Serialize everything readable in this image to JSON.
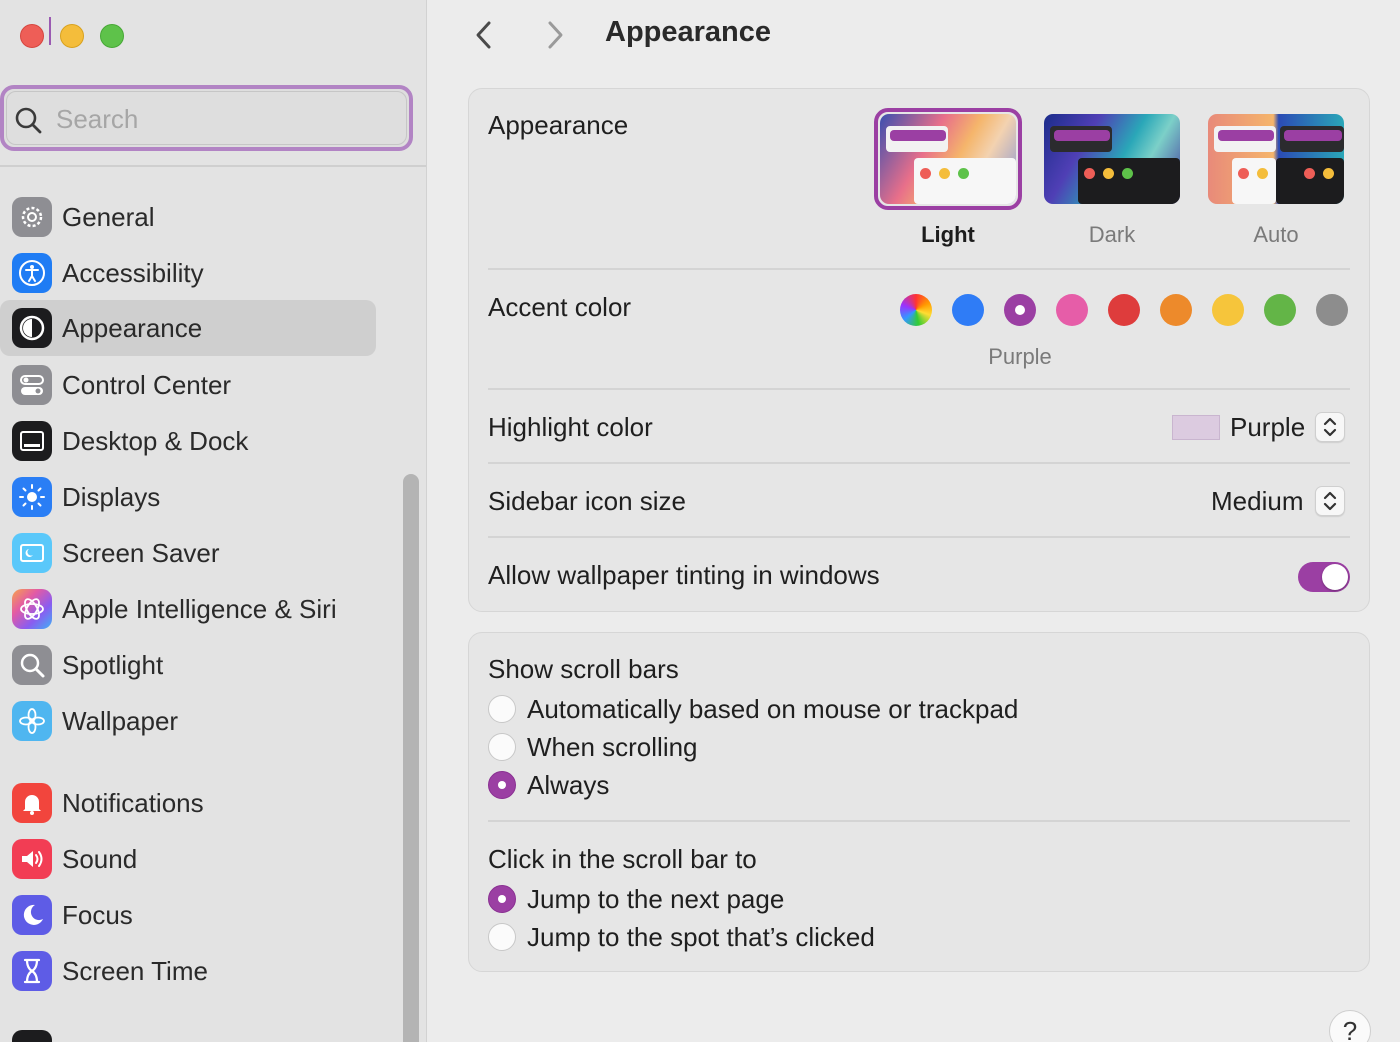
{
  "window": {
    "controls": [
      "close",
      "minimize",
      "zoom"
    ]
  },
  "search": {
    "placeholder": "Search",
    "value": ""
  },
  "sidebar": {
    "items": [
      {
        "label": "General",
        "icon": "gear-icon",
        "color": "#8e8e93"
      },
      {
        "label": "Accessibility",
        "icon": "accessibility-icon",
        "color": "#1f7cf4"
      },
      {
        "label": "Appearance",
        "icon": "appearance-icon",
        "color": "#1c1c1e",
        "active": true
      },
      {
        "label": "Control Center",
        "icon": "control-center-icon",
        "color": "#8e8e93"
      },
      {
        "label": "Desktop & Dock",
        "icon": "dock-icon",
        "color": "#1c1c1e"
      },
      {
        "label": "Displays",
        "icon": "sun-icon",
        "color": "#2a7ef5"
      },
      {
        "label": "Screen Saver",
        "icon": "screen-saver-icon",
        "color": "#5ac8fa"
      },
      {
        "label": "Apple Intelligence & Siri",
        "icon": "siri-icon",
        "color": "#d26be8"
      },
      {
        "label": "Spotlight",
        "icon": "magnifier-icon",
        "color": "#8e8e93"
      },
      {
        "label": "Wallpaper",
        "icon": "flower-icon",
        "color": "#4fb6f0"
      },
      {
        "label": "Notifications",
        "icon": "bell-icon",
        "color": "#f2453d"
      },
      {
        "label": "Sound",
        "icon": "speaker-icon",
        "color": "#f23d54"
      },
      {
        "label": "Focus",
        "icon": "moon-icon",
        "color": "#5e5ce6"
      },
      {
        "label": "Screen Time",
        "icon": "hourglass-icon",
        "color": "#5e5ce6"
      }
    ]
  },
  "header": {
    "title": "Appearance"
  },
  "appearance": {
    "label": "Appearance",
    "options": [
      {
        "label": "Light",
        "selected": true
      },
      {
        "label": "Dark",
        "selected": false
      },
      {
        "label": "Auto",
        "selected": false
      }
    ]
  },
  "accent": {
    "label": "Accent color",
    "selected_name": "Purple",
    "colors": [
      {
        "name": "Multicolor",
        "hex": "multicolor"
      },
      {
        "name": "Blue",
        "hex": "#2f7cf6"
      },
      {
        "name": "Purple",
        "hex": "#9b3fa3",
        "selected": true
      },
      {
        "name": "Pink",
        "hex": "#e65da8"
      },
      {
        "name": "Red",
        "hex": "#de3c3c"
      },
      {
        "name": "Orange",
        "hex": "#ed8a2b"
      },
      {
        "name": "Yellow",
        "hex": "#f6c53b"
      },
      {
        "name": "Green",
        "hex": "#63b547"
      },
      {
        "name": "Graphite",
        "hex": "#8d8d8d"
      }
    ]
  },
  "highlight": {
    "label": "Highlight color",
    "value": "Purple",
    "swatch": "#dccbe0"
  },
  "sidebar_icon_size": {
    "label": "Sidebar icon size",
    "value": "Medium"
  },
  "tinting": {
    "label": "Allow wallpaper tinting in windows",
    "on": true
  },
  "scroll_bars": {
    "label": "Show scroll bars",
    "options": [
      {
        "label": "Automatically based on mouse or trackpad",
        "checked": false
      },
      {
        "label": "When scrolling",
        "checked": false
      },
      {
        "label": "Always",
        "checked": true
      }
    ]
  },
  "click_scroll": {
    "label": "Click in the scroll bar to",
    "options": [
      {
        "label": "Jump to the next page",
        "checked": true
      },
      {
        "label": "Jump to the spot that’s clicked",
        "checked": false
      }
    ]
  },
  "help": {
    "label": "?"
  }
}
